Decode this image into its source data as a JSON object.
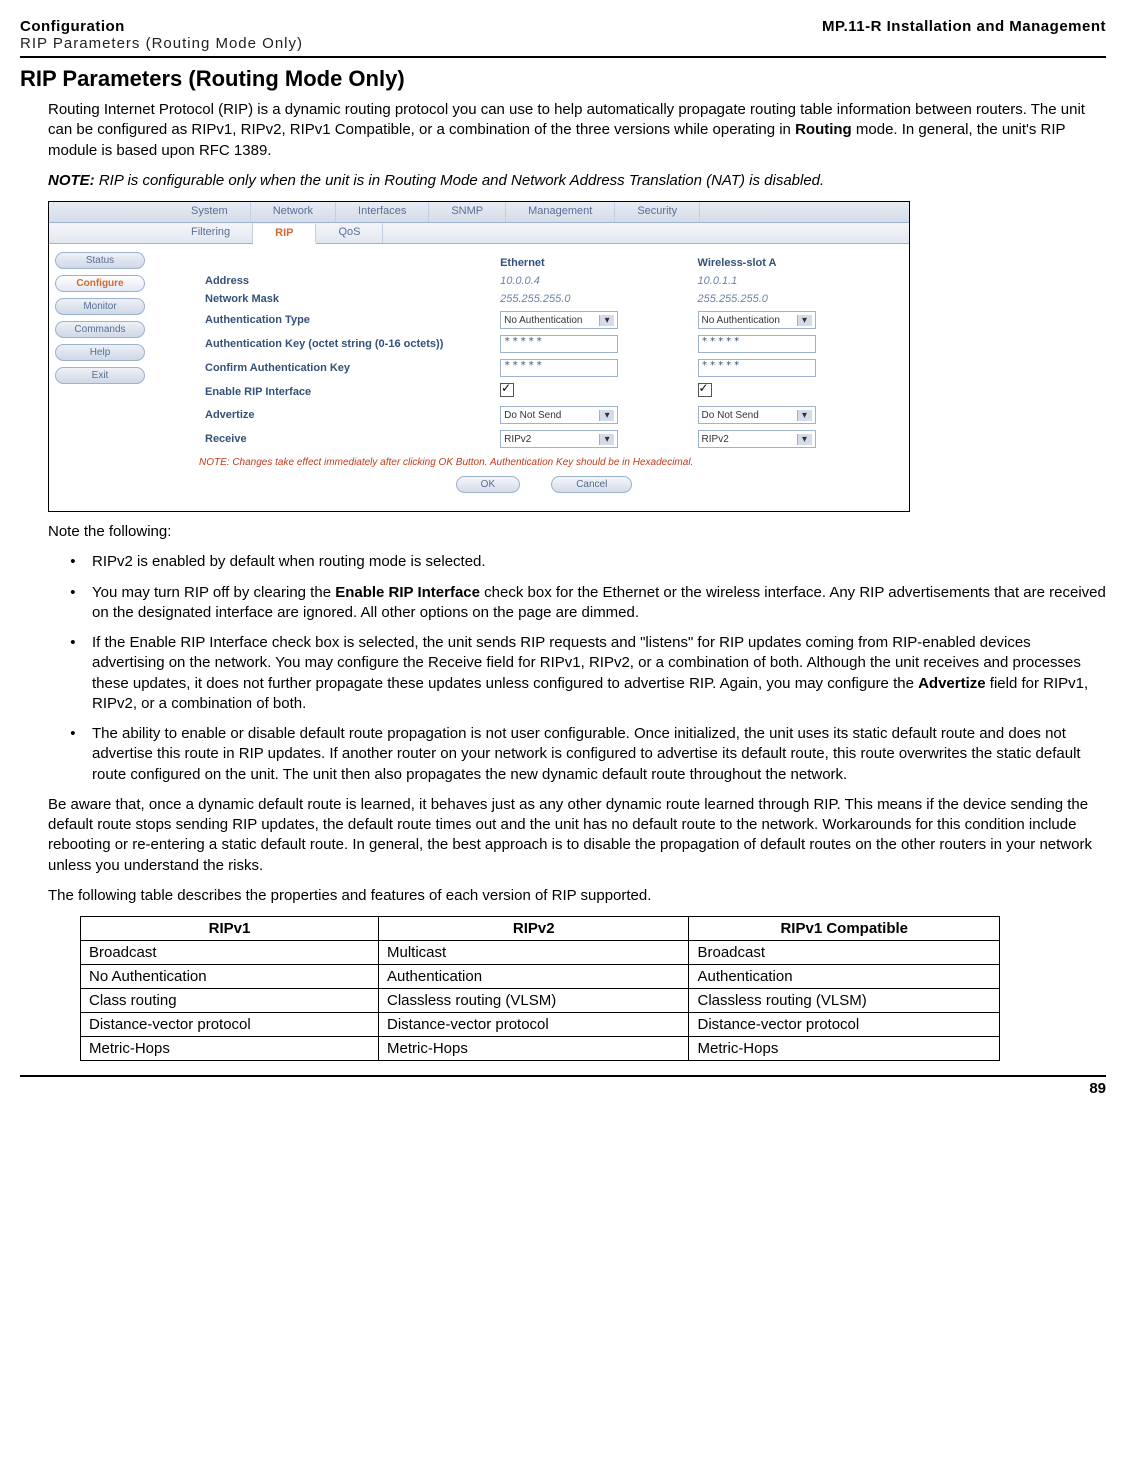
{
  "header": {
    "left_title": "Configuration",
    "left_sub": "RIP Parameters (Routing Mode Only)",
    "right_title": "MP.11-R Installation and Management"
  },
  "section_title": "RIP Parameters (Routing Mode Only)",
  "intro_p1a": "Routing Internet Protocol (RIP) is a dynamic routing protocol you can use to help automatically propagate routing table information between routers. The unit can be configured as RIPv1, RIPv2, RIPv1 Compatible, or a combination of the three versions while operating in ",
  "intro_p1_bold": "Routing",
  "intro_p1b": " mode. In general, the unit's RIP module is based upon RFC 1389.",
  "note_label": "NOTE:",
  "note_text": " RIP is configurable only when the unit is in Routing Mode and Network Address Translation (NAT) is disabled.",
  "after_shot": "Note the following:",
  "bullets": {
    "b1": "RIPv2 is enabled by default when routing mode is selected.",
    "b2a": "You may turn RIP off by clearing the ",
    "b2_bold": "Enable RIP Interface",
    "b2b": " check box for the Ethernet or the wireless interface. Any RIP advertisements that are received on the designated interface are ignored. All other options on the page are dimmed.",
    "b3a": "If the Enable RIP Interface check box is selected, the unit sends RIP requests and \"listens\" for RIP updates coming from RIP-enabled devices advertising on the network. You may configure the Receive field for RIPv1, RIPv2, or a combination of both. Although the unit receives and processes these updates, it does not further propagate these updates unless configured to advertise RIP. Again, you may configure the ",
    "b3_bold": "Advertize",
    "b3b": " field for RIPv1, RIPv2, or a combination of both.",
    "b4": "The ability to enable or disable default route propagation is not user configurable. Once initialized, the unit uses its static default route and does not advertise this route in RIP updates. If another router on your network is configured to advertise its default route, this route overwrites the static default route configured on the unit. The unit then also propagates the new dynamic default route throughout the network."
  },
  "aware_para": "Be aware that, once a dynamic default route is learned, it behaves just as any other dynamic route learned through RIP. This means if the device sending the default route stops sending RIP updates, the default route times out and the unit has no default route to the network. Workarounds for this condition include rebooting or re-entering a static default route. In general, the best approach is to disable the propagation of default routes on the other routers in your network unless you understand the risks.",
  "table_intro": "The following table describes the properties and features of each version of RIP supported.",
  "rip_table": {
    "headers": [
      "RIPv1",
      "RIPv2",
      "RIPv1 Compatible"
    ],
    "rows": [
      [
        "Broadcast",
        "Multicast",
        "Broadcast"
      ],
      [
        "No Authentication",
        "Authentication",
        "Authentication"
      ],
      [
        "Class routing",
        "Classless routing (VLSM)",
        "Classless routing (VLSM)"
      ],
      [
        "Distance-vector protocol",
        "Distance-vector protocol",
        "Distance-vector protocol"
      ],
      [
        "Metric-Hops",
        "Metric-Hops",
        "Metric-Hops"
      ]
    ]
  },
  "page_number": "89",
  "screenshot": {
    "tabs_top": [
      "System",
      "Network",
      "Interfaces",
      "SNMP",
      "Management",
      "Security"
    ],
    "tabs_sub": [
      "Filtering",
      "RIP",
      "QoS"
    ],
    "active_sub": "RIP",
    "side_buttons": [
      "Status",
      "Configure",
      "Monitor",
      "Commands",
      "Help",
      "Exit"
    ],
    "active_side": "Configure",
    "col_headers": [
      "Ethernet",
      "Wireless-slot A"
    ],
    "rows": {
      "address": {
        "label": "Address",
        "eth": "10.0.0.4",
        "wl": "10.0.1.1"
      },
      "mask": {
        "label": "Network Mask",
        "eth": "255.255.255.0",
        "wl": "255.255.255.0"
      },
      "authtype": {
        "label": "Authentication Type",
        "eth": "No Authentication",
        "wl": "No Authentication"
      },
      "authkey": {
        "label": "Authentication Key (octet string (0-16 octets))",
        "eth": "*****",
        "wl": "*****"
      },
      "confirm": {
        "label": "Confirm Authentication Key",
        "eth": "*****",
        "wl": "*****"
      },
      "enable": {
        "label": "Enable RIP Interface"
      },
      "advertize": {
        "label": "Advertize",
        "eth": "Do Not Send",
        "wl": "Do Not Send"
      },
      "receive": {
        "label": "Receive",
        "eth": "RIPv2",
        "wl": "RIPv2"
      }
    },
    "note": "NOTE: Changes take effect immediately after clicking OK Button. Authentication Key should be in Hexadecimal.",
    "buttons": {
      "ok": "OK",
      "cancel": "Cancel"
    }
  }
}
